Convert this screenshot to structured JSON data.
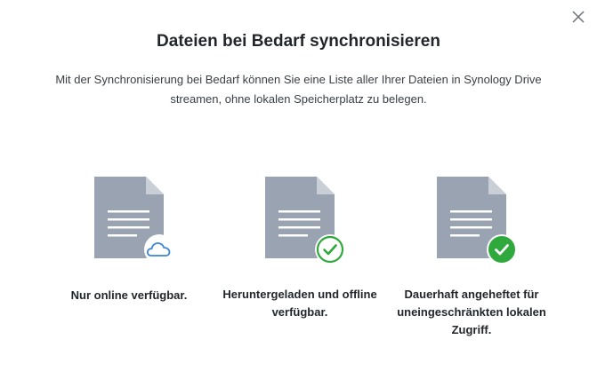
{
  "dialog": {
    "title": "Dateien bei Bedarf synchronisieren",
    "description": "Mit der Synchronisierung bei Bedarf können Sie eine Liste aller Ihrer Dateien in Synology Drive streamen, ohne lokalen Speicherplatz zu belegen."
  },
  "options": [
    {
      "icon": "cloud-icon",
      "label": "Nur online verfügbar."
    },
    {
      "icon": "check-outline-icon",
      "label": "Heruntergeladen und offline verfügbar."
    },
    {
      "icon": "check-filled-icon",
      "label": "Dauerhaft angeheftet für uneingeschränkten lokalen Zugriff."
    }
  ],
  "colors": {
    "document": "#9aa3b2",
    "document_fold": "#c9ced7",
    "cloud": "#3b86d6",
    "check_green": "#2fa83c"
  }
}
